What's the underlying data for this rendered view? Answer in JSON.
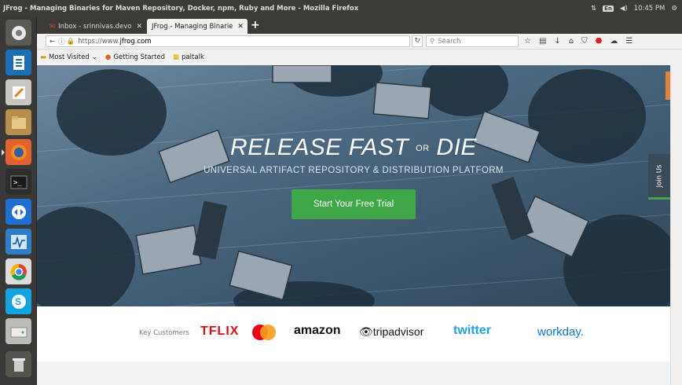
{
  "window": {
    "title": "JFrog - Managing Binaries for Maven Repository, Docker, npm, Ruby and More - Mozilla Firefox",
    "clock": "10:45 PM",
    "keyboard_layout": "En"
  },
  "launcher": {
    "items": [
      "home-folder-icon",
      "writer-icon",
      "text-editor-icon",
      "files-icon",
      "firefox-icon",
      "terminal-icon",
      "teamviewer-icon",
      "system-monitor-icon",
      "chrome-icon",
      "skype-icon",
      "disk-icon",
      "trash-icon"
    ]
  },
  "tabs": [
    {
      "label": "Inbox - srinnivas.devo",
      "active": false
    },
    {
      "label": "JFrog - Managing Binarie",
      "active": true
    }
  ],
  "nav": {
    "url_prefix": "https://www.",
    "url_host": "jfrog.com",
    "search_placeholder": "Search"
  },
  "bookmarks": [
    {
      "label": "Most Visited",
      "dropdown": true
    },
    {
      "label": "Getting Started",
      "dropdown": false
    },
    {
      "label": "paltalk",
      "dropdown": false
    }
  ],
  "hero": {
    "title_left": "RELEASE FAST",
    "title_or": "OR",
    "title_right": "DIE",
    "subtitle": "UNIVERSAL ARTIFACT REPOSITORY & DISTRIBUTION PLATFORM",
    "cta_label": "Start Your Free Trial",
    "join_label": "Join Us"
  },
  "customers": {
    "label": "Key Customers",
    "logos": [
      "TFLIX",
      "MasterCard",
      "amazon",
      "tripadvisor",
      "twitter",
      "workday."
    ]
  },
  "colors": {
    "accent_green": "#40a748",
    "panel_bg": "#3c3b37",
    "netflix_red": "#e50914",
    "twitter_blue": "#1da1f2",
    "workday_blue": "#0875e1"
  }
}
